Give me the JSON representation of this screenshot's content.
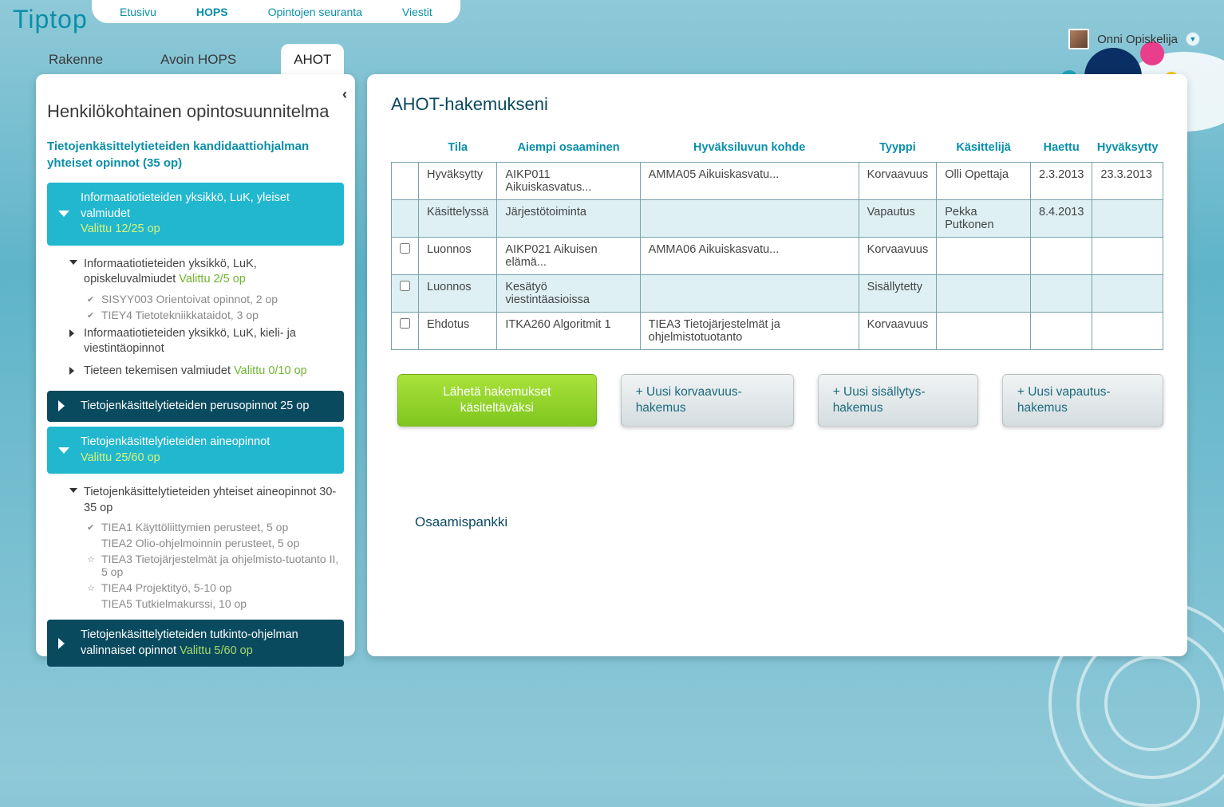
{
  "app": {
    "name": "Tiptop"
  },
  "topnav": {
    "items": [
      {
        "label": "Etusivu"
      },
      {
        "label": "HOPS",
        "active": true
      },
      {
        "label": "Opintojen seuranta"
      },
      {
        "label": "Viestit"
      }
    ]
  },
  "user": {
    "name": "Onni Opiskelija"
  },
  "subtabs": {
    "items": [
      {
        "label": "Rakenne"
      },
      {
        "label": "Avoin HOPS"
      },
      {
        "label": "AHOT",
        "active": true
      }
    ]
  },
  "left": {
    "title": "Henkilökohtainen opintosuunnitelma",
    "program": "Tietojenkäsittelytieteiden kandidaattiohjalman yhteiset opinnot (35 op)",
    "g1": {
      "label": "Informaatiotieteiden yksikkö, LuK, yleiset valmiudet",
      "sub": "Valittu 12/25 op"
    },
    "n1": {
      "label": "Informaatiotieteiden yksikkö, LuK, opiskeluvalmiudet",
      "sub": "Valittu 2/5 op"
    },
    "l1": "SISYY003 Orientoivat opinnot, 2 op",
    "l2": "TIEY4 Tietotekniikkataidot, 3 op",
    "n2": {
      "label": "Informaatiotieteiden yksikkö, LuK, kieli- ja viestintäopinnot"
    },
    "n3": {
      "label": "Tieteen tekemisen valmiudet",
      "sub": "Valittu 0/10 op"
    },
    "g2": {
      "label": "Tietojenkäsittelytieteiden perusopinnot 25 op"
    },
    "g3": {
      "label": "Tietojenkäsittelytieteiden aineopinnot",
      "sub": "Valittu 25/60 op"
    },
    "n4": {
      "label": "Tietojenkäsittelytieteiden yhteiset aineopinnot 30-35 op"
    },
    "l3": "TIEA1 Käyttöliittymien perusteet, 5 op",
    "l4": "TIEA2 Olio-ohjelmoinnin perusteet, 5 op",
    "l5": "TIEA3 Tietojärjestelmät ja ohjelmisto-tuotanto II, 5 op",
    "l6": "TIEA4 Projektityö, 5-10 op",
    "l7": "TIEA5 Tutkielmakurssi, 10 op",
    "g4": {
      "label": "Tietojenkäsittelytieteiden tutkinto-ohjelman valinnaiset opinnot",
      "sub": "Valittu 5/60 op"
    }
  },
  "right": {
    "title": "AHOT-hakemukseni",
    "headers": {
      "c0": "",
      "c1": "Tila",
      "c2": "Aiempi  osaaminen",
      "c3": "Hyväksiluvun kohde",
      "c4": "Tyyppi",
      "c5": "Käsittelijä",
      "c6": "Haettu",
      "c7": "Hyväksytty"
    },
    "rows": [
      {
        "chk": false,
        "tila": "Hyväksytty",
        "aiempi": "AIKP011 Aikuiskasvatus...",
        "kohde": "AMMA05 Aikuiskasvatu...",
        "tyyppi": "Korvaavuus",
        "kasit": "Olli Opettaja",
        "haettu": "2.3.2013",
        "hyv": "23.3.2013"
      },
      {
        "chk": false,
        "tila": "Käsittelyssä",
        "aiempi": "Järjestötoiminta",
        "kohde": "",
        "tyyppi": "Vapautus",
        "kasit": "Pekka Putkonen",
        "haettu": "8.4.2013",
        "hyv": ""
      },
      {
        "chk": true,
        "tila": "Luonnos",
        "aiempi": "AIKP021 Aikuisen elämä...",
        "kohde": "AMMA06 Aikuiskasvatu...",
        "tyyppi": "Korvaavuus",
        "kasit": "",
        "haettu": "",
        "hyv": ""
      },
      {
        "chk": true,
        "tila": "Luonnos",
        "aiempi": "Kesätyö viestintäasioissa",
        "kohde": "",
        "tyyppi": "Sisällytetty",
        "kasit": "",
        "haettu": "",
        "hyv": ""
      },
      {
        "chk": true,
        "tila": "Ehdotus",
        "aiempi": "ITKA260 Algoritmit 1",
        "kohde": "TIEA3 Tietojärjestelmät ja ohjelmistotuotanto",
        "tyyppi": "Korvaavuus",
        "kasit": "",
        "haettu": "",
        "hyv": ""
      }
    ],
    "buttons": {
      "submit": "Lähetä hakemukset käsiteltäväksi",
      "new1": "+ Uusi korvaavuus-hakemus",
      "new2": "+ Uusi sisällytys-hakemus",
      "new3": "+ Uusi vapautus-hakemus"
    },
    "section": "Osaamispankki"
  }
}
